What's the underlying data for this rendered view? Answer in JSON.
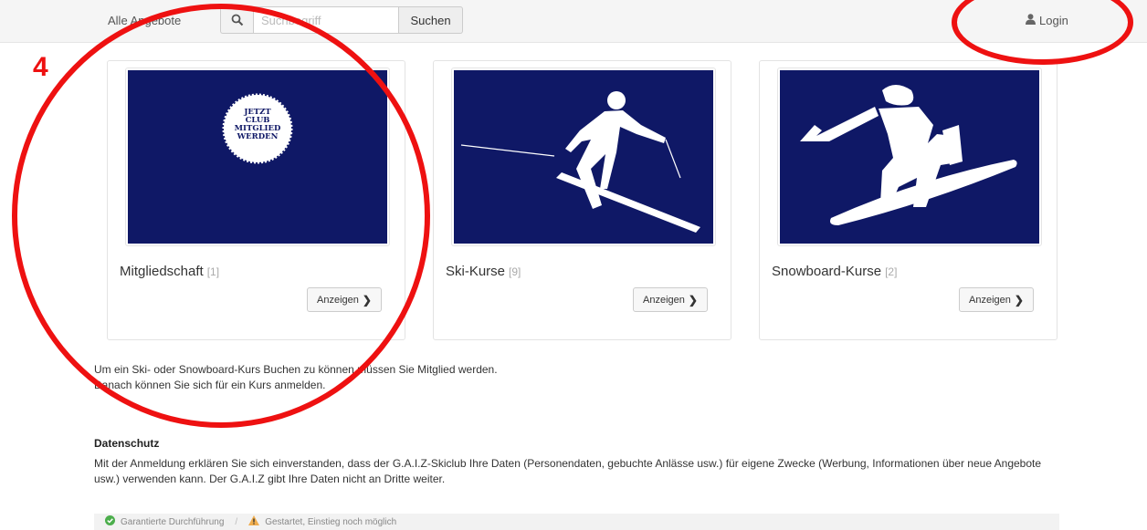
{
  "nav": {
    "all_offers": "Alle Angebote",
    "login": "Login"
  },
  "search": {
    "placeholder": "Suchbegriff",
    "button": "Suchen"
  },
  "annotation": {
    "step": "4"
  },
  "cards": [
    {
      "title": "Mitgliedschaft",
      "count": "[1]",
      "button": "Anzeigen",
      "badge": [
        "JETZT",
        "CLUB",
        "MITGLIED",
        "WERDEN"
      ]
    },
    {
      "title": "Ski-Kurse",
      "count": "[9]",
      "button": "Anzeigen"
    },
    {
      "title": "Snowboard-Kurse",
      "count": "[2]",
      "button": "Anzeigen"
    }
  ],
  "info": {
    "line1": "Um ein Ski- oder Snowboard-Kurs Buchen zu können müssen Sie Mitglied werden.",
    "line2": "Danach können Sie sich für ein Kurs anmelden."
  },
  "privacy": {
    "title": "Datenschutz",
    "text": "Mit der Anmeldung erklären Sie sich einverstanden, dass der G.A.I.Z-Skiclub Ihre Daten (Personendaten, gebuchte Anlässe usw.) für eigene Zwecke (Werbung, Informationen über neue Angebote usw.) verwenden kann. Der G.A.I.Z gibt Ihre Daten nicht an Dritte weiter."
  },
  "legend": {
    "guaranteed": "Garantierte Durchführung",
    "separator": "/",
    "started": "Gestartet, Einstieg noch möglich"
  },
  "colors": {
    "accent": "#e11111",
    "image_bg": "#0f1866",
    "check": "#4cae4c",
    "warning": "#f0ad4e"
  }
}
